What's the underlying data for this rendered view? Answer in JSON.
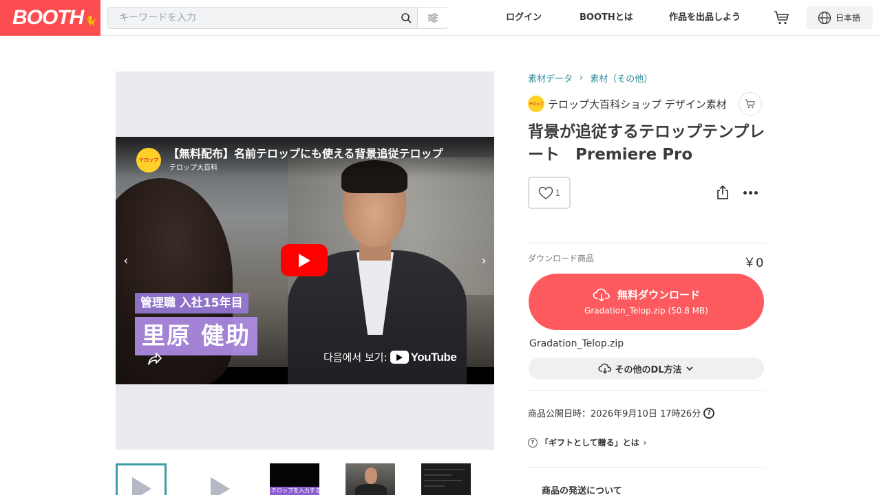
{
  "header": {
    "logo": "BOOTH",
    "search_placeholder": "キーワードを入力",
    "nav": [
      "ログイン",
      "BOOTHとは",
      "作品を出品しよう"
    ],
    "language": "日本語",
    "brand_color": "#fc4d50"
  },
  "video": {
    "title": "【無料配布】名前テロップにも使える背景追従テロップ",
    "channel": "テロップ大百科",
    "avatar_text": "テロップ",
    "telop_role": "管理職 入社15年目",
    "telop_name": "里原 健助",
    "watch_on": "다음에서 보기:",
    "youtube": "YouTube",
    "thumb_caption": "テロップを入力する"
  },
  "breadcrumb": [
    "素材データ",
    "素材（その他）"
  ],
  "shop": {
    "name": "テロップ大百科ショップ デザイン素材",
    "avatar_text": "テロップ"
  },
  "product": {
    "title": "背景が追従するテロップテンプレート　Premiere Pro",
    "likes": "1",
    "download_label": "ダウンロード商品",
    "price": "￥0",
    "download_button": "無料ダウンロード",
    "download_file": "Gradation_Telop.zip (50.8 MB)",
    "file_name": "Gradation_Telop.zip",
    "other_dl": "その他のDL方法",
    "published": "商品公開日時：2026年9月10日 17時26分",
    "gift": "「ギフトとして贈る」とは",
    "shipping": "商品の発送について",
    "accent_color": "#fc5a5e",
    "link_color": "#2a8a98"
  }
}
